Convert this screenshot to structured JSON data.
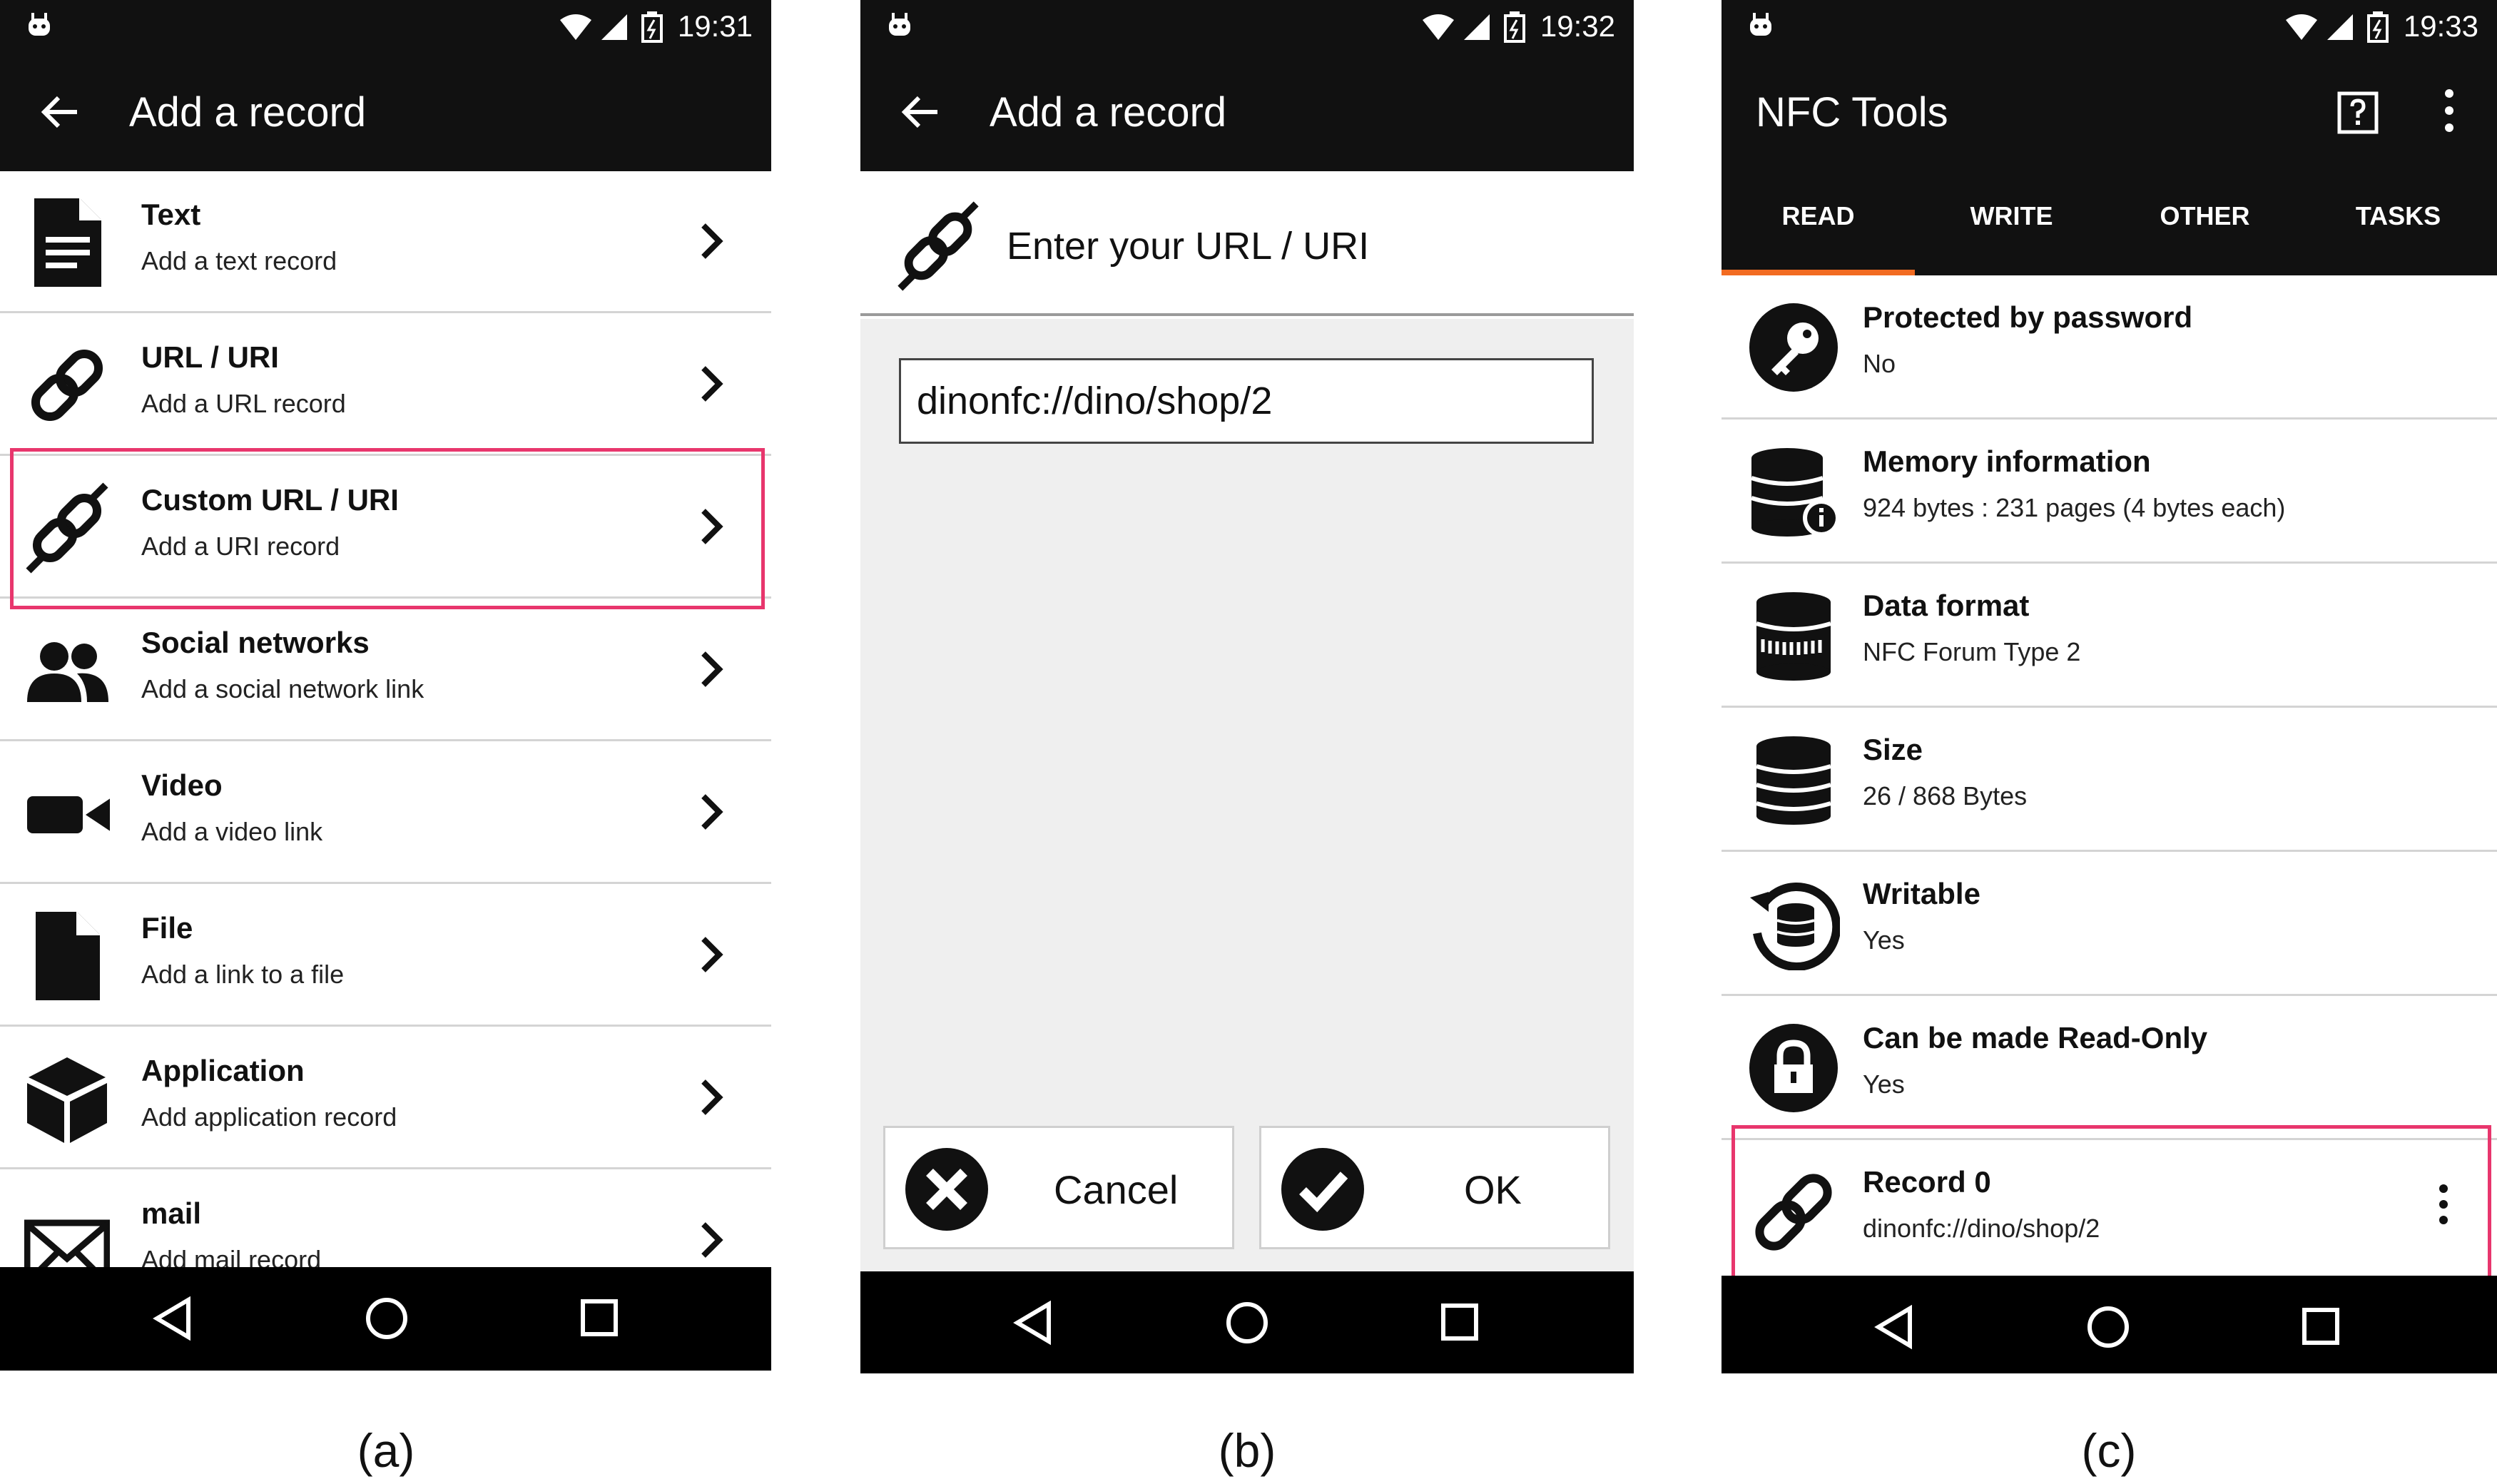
{
  "panel_a": {
    "status": {
      "time": "19:31"
    },
    "title": "Add a record",
    "items": [
      {
        "title": "Text",
        "subtitle": "Add a text record",
        "icon": "text-document-icon"
      },
      {
        "title": "URL / URI",
        "subtitle": "Add a URL record",
        "icon": "link-icon"
      },
      {
        "title": "Custom URL / URI",
        "subtitle": "Add a URI record",
        "icon": "broken-link-icon",
        "highlighted": true
      },
      {
        "title": "Social networks",
        "subtitle": "Add a social network link",
        "icon": "people-icon"
      },
      {
        "title": "Video",
        "subtitle": "Add a video link",
        "icon": "video-camera-icon"
      },
      {
        "title": "File",
        "subtitle": "Add a link to a file",
        "icon": "file-icon"
      },
      {
        "title": "Application",
        "subtitle": "Add application record",
        "icon": "cube-icon"
      },
      {
        "title": "mail",
        "subtitle": "Add mail record",
        "icon": "envelope-icon"
      }
    ],
    "caption": "(a)"
  },
  "panel_b": {
    "status": {
      "time": "19:32"
    },
    "title": "Add a record",
    "prompt": "Enter your URL / URI",
    "url_value": "dinonfc://dino/shop/2",
    "cancel_label": "Cancel",
    "ok_label": "OK",
    "caption": "(b)"
  },
  "panel_c": {
    "status": {
      "time": "19:33"
    },
    "title": "NFC Tools",
    "tabs": [
      {
        "label": "READ",
        "active": true
      },
      {
        "label": "WRITE",
        "active": false
      },
      {
        "label": "OTHER",
        "active": false
      },
      {
        "label": "TASKS",
        "active": false
      }
    ],
    "items": [
      {
        "title": "Protected by password",
        "value": "No",
        "icon": "key-icon"
      },
      {
        "title": "Memory information",
        "value": "924 bytes : 231 pages (4 bytes each)",
        "icon": "database-info-icon"
      },
      {
        "title": "Data format",
        "value": "NFC Forum Type 2",
        "icon": "database-format-icon"
      },
      {
        "title": "Size",
        "value": "26 / 868 Bytes",
        "icon": "database-icon"
      },
      {
        "title": "Writable",
        "value": "Yes",
        "icon": "database-refresh-icon"
      },
      {
        "title": "Can be made Read-Only",
        "value": "Yes",
        "icon": "lock-icon"
      },
      {
        "title": "Record 0",
        "value": "dinonfc://dino/shop/2",
        "icon": "link-icon",
        "highlighted": true
      }
    ],
    "caption": "(c)"
  },
  "colors": {
    "highlight": "#e8366d",
    "tab_indicator": "#f26b21",
    "bar": "#111111"
  }
}
